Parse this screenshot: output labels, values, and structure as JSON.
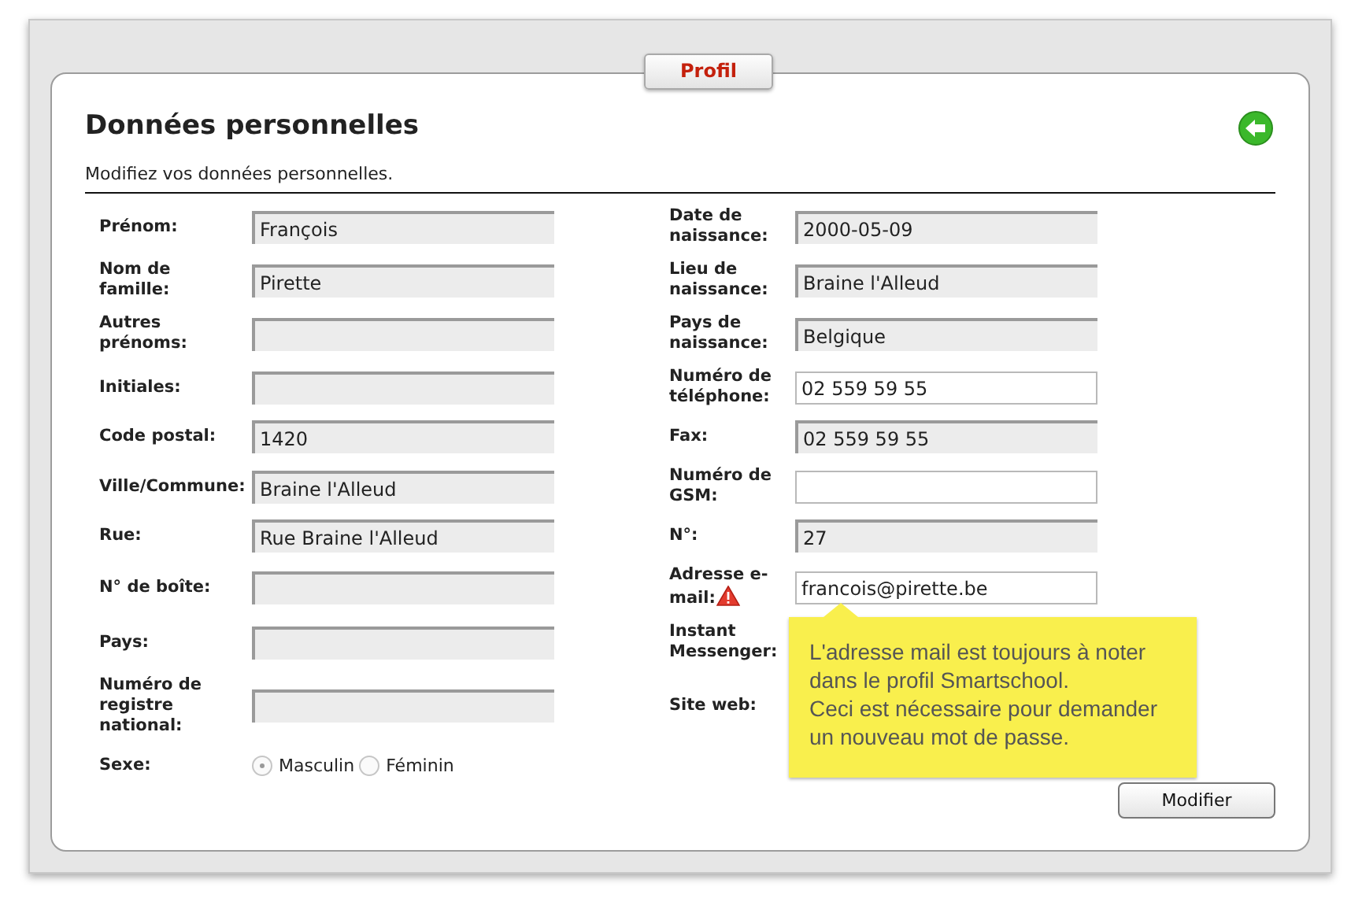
{
  "tab": {
    "label": "Profil"
  },
  "heading": "Données personnelles",
  "subtitle": "Modifiez vos données personnelles.",
  "left_fields": [
    {
      "kind": "text",
      "label": "Prénom:",
      "value": "François",
      "editable": false
    },
    {
      "kind": "text",
      "label": "Nom de famille:",
      "value": "Pirette",
      "editable": false
    },
    {
      "kind": "text",
      "label": "Autres prénoms:",
      "editable": false
    },
    {
      "kind": "text",
      "label": "Initiales:",
      "editable": false
    },
    {
      "kind": "text",
      "label": "Code postal:",
      "value": "1420",
      "editable": false
    },
    {
      "kind": "text",
      "label": "Ville/Commune:",
      "value": "Braine l'Alleud",
      "editable": false
    },
    {
      "kind": "text",
      "label": "Rue:",
      "value": "Rue Braine l'Alleud",
      "editable": false
    },
    {
      "kind": "text",
      "label": "N° de boîte:",
      "editable": false
    },
    {
      "kind": "text",
      "label": "Pays:",
      "editable": false
    },
    {
      "kind": "text",
      "label": "Numéro de registre national:",
      "editable": false
    },
    {
      "kind": "radio",
      "label": "Sexe:",
      "options": [
        {
          "label": "Masculin",
          "selected": true
        },
        {
          "label": "Féminin",
          "selected": false
        }
      ]
    }
  ],
  "right_fields": [
    {
      "kind": "text",
      "label": "Date de naissance:",
      "value": "2000-05-09",
      "editable": false
    },
    {
      "kind": "text",
      "label": "Lieu de naissance:",
      "value": "Braine l'Alleud",
      "editable": false
    },
    {
      "kind": "text",
      "label": "Pays de naissance:",
      "value": "Belgique",
      "editable": false
    },
    {
      "kind": "text",
      "label": "Numéro de téléphone:",
      "value": "02 559 59 55",
      "editable": true
    },
    {
      "kind": "text",
      "label": "Fax:",
      "value": "02 559 59 55",
      "editable": false
    },
    {
      "kind": "text",
      "label": "Numéro de GSM:",
      "editable": true
    },
    {
      "kind": "text",
      "label": "N°:",
      "value": "27",
      "editable": false
    },
    {
      "kind": "text",
      "label": "Adresse e-mail:",
      "value": "francois@pirette.be",
      "editable": true,
      "warning": true
    },
    {
      "kind": "label",
      "label": "Instant Messenger:"
    },
    {
      "kind": "label",
      "label": "Site web:"
    }
  ],
  "tooltip": {
    "lines": [
      "L'adresse mail est toujours à noter dans le profil Smartschool.",
      "Ceci est nécessaire pour demander un nouveau mot de passe."
    ]
  },
  "submit_button": "Modifier"
}
